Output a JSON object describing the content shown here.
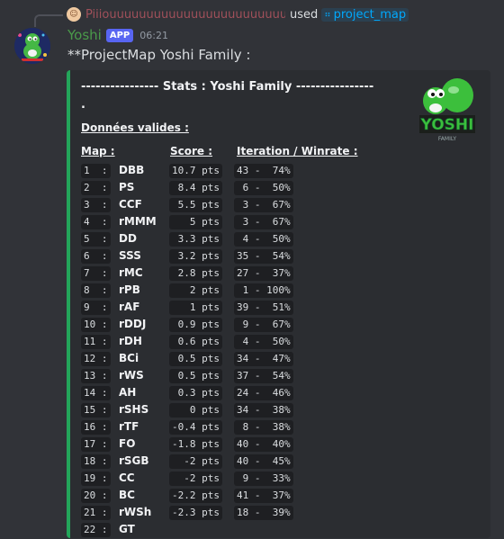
{
  "reply": {
    "username": "Piiiouuuuuuuuuuuuuuuuuuuuuuuuuuuuuu",
    "used": "used",
    "command": "project_map"
  },
  "message": {
    "username": "Yoshi",
    "badge": "APP",
    "time": "06:21",
    "content": "**ProjectMap Yoshi Family  :"
  },
  "embed": {
    "accent_color": "#23a55a",
    "title": "---------------- Stats : Yoshi Family ----------------\n.",
    "subtitle": "Données valides :",
    "headers": {
      "map": "Map :",
      "score": "Score :",
      "iteration": "Iteration / Winrate :"
    },
    "rows": [
      {
        "num": "1  :",
        "map": "DBB",
        "score": "10.7 pts",
        "iter": "43 -  74%"
      },
      {
        "num": "2  :",
        "map": "PS",
        "score": " 8.4 pts",
        "iter": " 6 -  50%"
      },
      {
        "num": "3  :",
        "map": "CCF",
        "score": " 5.5 pts",
        "iter": " 3 -  67%"
      },
      {
        "num": "4  :",
        "map": "rMMM",
        "score": "   5 pts",
        "iter": " 3 -  67%"
      },
      {
        "num": "5  :",
        "map": "DD",
        "score": " 3.3 pts",
        "iter": " 4 -  50%"
      },
      {
        "num": "6  :",
        "map": "SSS",
        "score": " 3.2 pts",
        "iter": "35 -  54%"
      },
      {
        "num": "7  :",
        "map": "rMC",
        "score": " 2.8 pts",
        "iter": "27 -  37%"
      },
      {
        "num": "8  :",
        "map": "rPB",
        "score": "   2 pts",
        "iter": " 1 - 100%"
      },
      {
        "num": "9  :",
        "map": "rAF",
        "score": "   1 pts",
        "iter": "39 -  51%"
      },
      {
        "num": "10 :",
        "map": "rDDJ",
        "score": " 0.9 pts",
        "iter": " 9 -  67%"
      },
      {
        "num": "11 :",
        "map": "rDH",
        "score": " 0.6 pts",
        "iter": " 4 -  50%"
      },
      {
        "num": "12 :",
        "map": "BCi",
        "score": " 0.5 pts",
        "iter": "34 -  47%"
      },
      {
        "num": "13 :",
        "map": "rWS",
        "score": " 0.5 pts",
        "iter": "37 -  54%"
      },
      {
        "num": "14 :",
        "map": "AH",
        "score": " 0.3 pts",
        "iter": "24 -  46%"
      },
      {
        "num": "15 :",
        "map": "rSHS",
        "score": "   0 pts",
        "iter": "34 -  38%"
      },
      {
        "num": "16 :",
        "map": "rTF",
        "score": "-0.4 pts",
        "iter": " 8 -  38%"
      },
      {
        "num": "17 :",
        "map": "FO",
        "score": "-1.8 pts",
        "iter": "40 -  40%"
      },
      {
        "num": "18 :",
        "map": "rSGB",
        "score": "  -2 pts",
        "iter": "40 -  45%"
      },
      {
        "num": "19 :",
        "map": "CC",
        "score": "  -2 pts",
        "iter": " 9 -  33%"
      },
      {
        "num": "20 :",
        "map": "BC",
        "score": "-2.2 pts",
        "iter": "41 -  37%"
      },
      {
        "num": "21 :",
        "map": "rWSh",
        "score": "-2.3 pts",
        "iter": "18 -  39%"
      },
      {
        "num": "22 :",
        "map": "GT",
        "score": "",
        "iter": ""
      }
    ]
  },
  "thumbnail": {
    "text": "YOSHI",
    "sub": "FAMILY"
  }
}
